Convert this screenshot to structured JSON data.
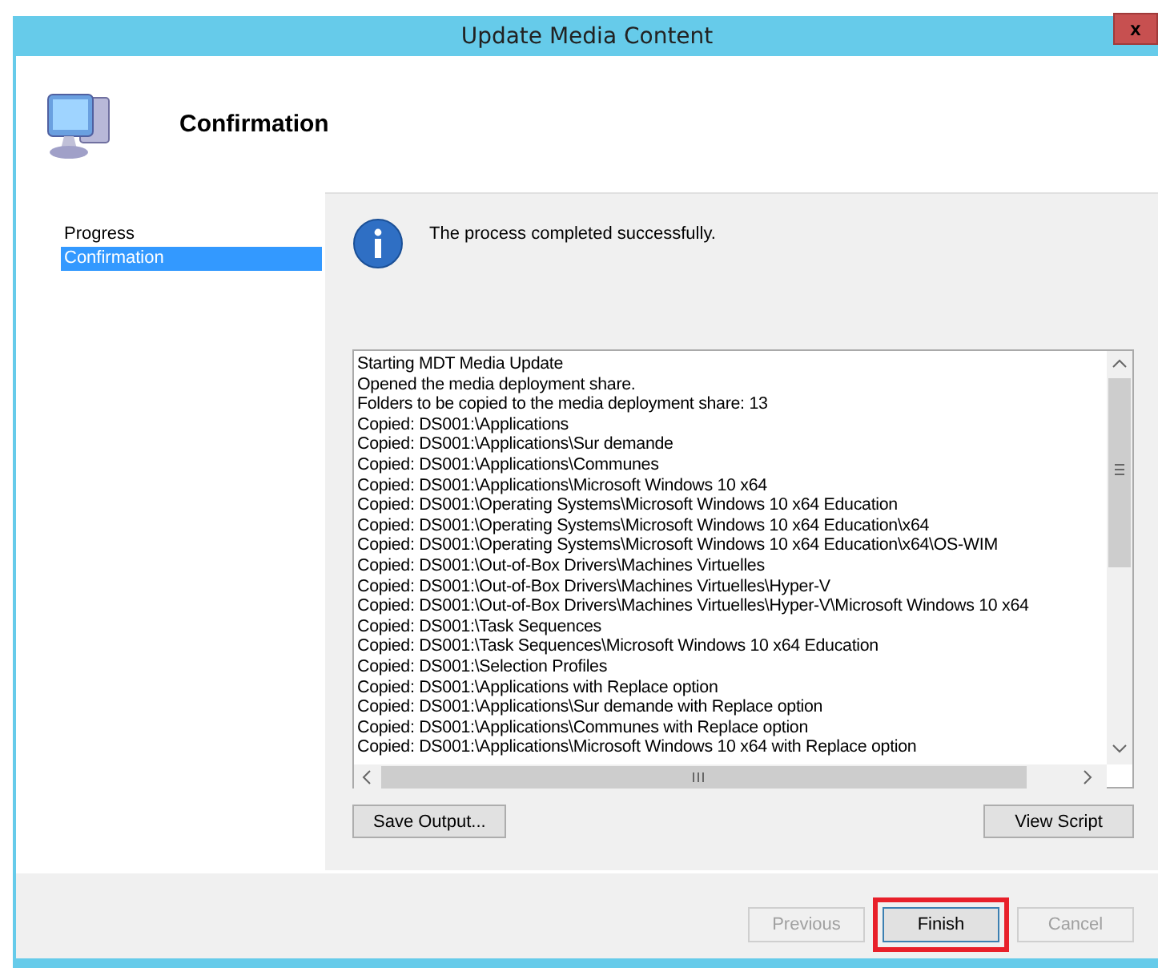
{
  "window": {
    "title": "Update Media Content",
    "close_label": "x"
  },
  "header": {
    "title": "Confirmation"
  },
  "sidebar": {
    "items": [
      {
        "label": "Progress",
        "selected": false
      },
      {
        "label": "Confirmation",
        "selected": true
      }
    ]
  },
  "message": "The process completed successfully.",
  "log": {
    "lines": [
      "Starting MDT Media Update",
      "Opened the media deployment share.",
      "Folders to be copied to the media deployment share: 13",
      "Copied: DS001:\\Applications",
      "Copied: DS001:\\Applications\\Sur demande",
      "Copied: DS001:\\Applications\\Communes",
      "Copied: DS001:\\Applications\\Microsoft Windows 10 x64",
      "Copied: DS001:\\Operating Systems\\Microsoft Windows 10 x64 Education",
      "Copied: DS001:\\Operating Systems\\Microsoft Windows 10 x64 Education\\x64",
      "Copied: DS001:\\Operating Systems\\Microsoft Windows 10 x64 Education\\x64\\OS-WIM",
      "Copied: DS001:\\Out-of-Box Drivers\\Machines Virtuelles",
      "Copied: DS001:\\Out-of-Box Drivers\\Machines Virtuelles\\Hyper-V",
      "Copied: DS001:\\Out-of-Box Drivers\\Machines Virtuelles\\Hyper-V\\Microsoft Windows 10 x64",
      "Copied: DS001:\\Task Sequences",
      "Copied: DS001:\\Task Sequences\\Microsoft Windows 10 x64 Education",
      "Copied: DS001:\\Selection Profiles",
      "Copied: DS001:\\Applications with Replace option",
      "Copied: DS001:\\Applications\\Sur demande with Replace option",
      "Copied: DS001:\\Applications\\Communes with Replace option",
      "Copied: DS001:\\Applications\\Microsoft Windows 10 x64 with Replace option"
    ]
  },
  "actions": [
    {
      "label": "Save Output..."
    },
    {
      "label": "View Script"
    }
  ],
  "footer_buttons": [
    {
      "label": "Previous",
      "disabled": true,
      "highlighted": false
    },
    {
      "label": "Finish",
      "disabled": false,
      "highlighted": true
    },
    {
      "label": "Cancel",
      "disabled": true,
      "highlighted": false
    }
  ]
}
